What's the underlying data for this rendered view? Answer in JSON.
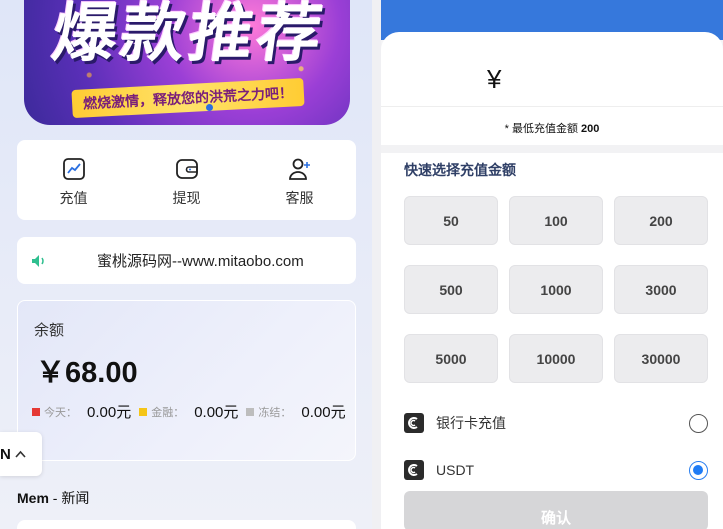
{
  "banner": {
    "title": "爆款推荐",
    "slogan": "燃烧激情，释放您的洪荒之力吧！"
  },
  "actions": [
    {
      "label": "充值",
      "icon": "chart-line-icon"
    },
    {
      "label": "提现",
      "icon": "wallet-icon"
    },
    {
      "label": "客服",
      "icon": "add-user-icon"
    }
  ],
  "notice": {
    "icon": "speaker-icon",
    "text": "蜜桃源码网--www.mitaobo.com"
  },
  "balance": {
    "label": "余额",
    "amount": "￥68.00",
    "stats": [
      {
        "label": "今天：",
        "value": "0.00元",
        "color": "#e53935"
      },
      {
        "label": "金融：",
        "value": "0.00元",
        "color": "#f5c518"
      },
      {
        "label": "冻结：",
        "value": "0.00元",
        "color": "#bdbdbd"
      }
    ]
  },
  "language": {
    "code": "N",
    "chevron": "^"
  },
  "news": {
    "brand": "Mem",
    "separator": " - ",
    "label": "新闻"
  },
  "recharge": {
    "currency_symbol": "¥",
    "min_prefix": "* 最低充值金额 ",
    "min_amount": "200",
    "quick_title": "快速选择充值金额",
    "amounts": [
      "50",
      "100",
      "200",
      "500",
      "1000",
      "3000",
      "5000",
      "10000",
      "30000"
    ],
    "methods": [
      {
        "label": "银行卡充值",
        "selected": false
      },
      {
        "label": "USDT",
        "selected": true
      }
    ],
    "confirm_label": "确认"
  },
  "colors": {
    "header_blue": "#3678dc",
    "radio_selected": "#1f7cf6",
    "quick_title": "#2f3f66"
  }
}
